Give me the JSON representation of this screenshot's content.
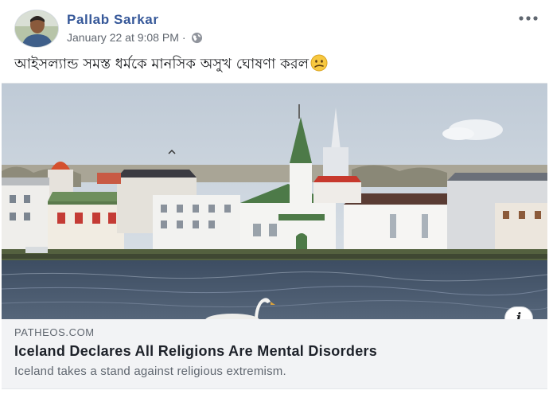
{
  "post": {
    "author": "Pallab Sarkar",
    "timestamp": "January 22 at 9:08 PM",
    "separator": "·",
    "audience_icon": "globe-icon",
    "more_icon": "more-options-icon",
    "message": "আইসল্যান্ড সমস্ত ধর্মকে মানসিক অসুখ ঘোষণা করল",
    "message_emoji": "confused-face-emoji"
  },
  "link_preview": {
    "domain": "PATHEOS.COM",
    "headline": "Iceland Declares All Religions Are Mental Disorders",
    "description": "Iceland takes a stand against religious extremism.",
    "info_label": "i"
  },
  "colors": {
    "author_link": "#365899",
    "caption_bg": "#f2f3f5",
    "muted_text": "#606770"
  }
}
